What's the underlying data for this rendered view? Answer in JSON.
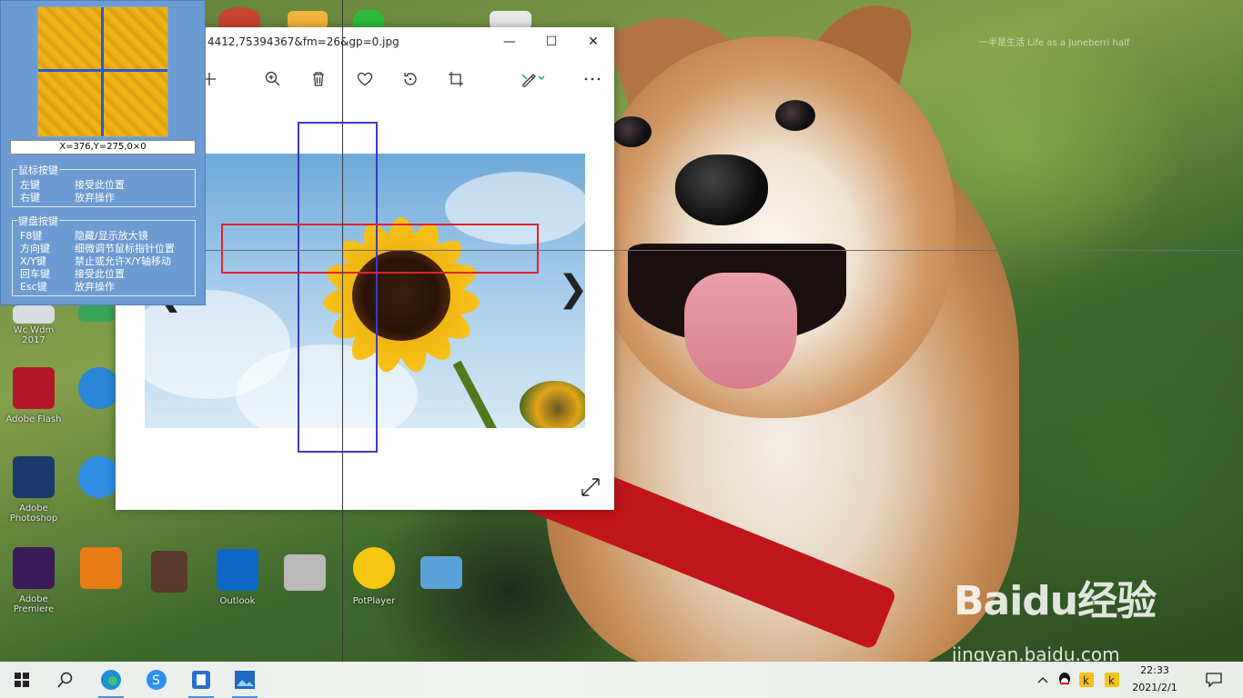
{
  "wallpaper": {
    "caption": "一半是生活 Life as a Juneberri half"
  },
  "desktop_icons": [
    {
      "label": "Wc Wdm 2017",
      "color": "#d7dde0"
    },
    {
      "label": "Adobe Flash",
      "color": "#b3162a"
    },
    {
      "label": "",
      "color": "#2a86d8"
    },
    {
      "label": "Adobe Photoshop",
      "color": "#1b3a6b"
    },
    {
      "label": "",
      "color": "#2f8de3"
    },
    {
      "label": "Adobe Premiere",
      "color": "#3c1a5a"
    },
    {
      "label": "",
      "color": "#e77c16"
    },
    {
      "label": "",
      "color": "#5a3a2a"
    },
    {
      "label": "Outlook",
      "color": "#0e67c4"
    },
    {
      "label": "",
      "color": "#b9b9b9"
    },
    {
      "label": "PotPlayer",
      "color": "#f4c712"
    },
    {
      "label": "",
      "color": "#5aa1d9"
    }
  ],
  "photos_window": {
    "title": "4412,75394367&fm=26&gp=0.jpg",
    "controls": {
      "minimize": "—",
      "maximize": "☐",
      "close": "✕"
    },
    "toolbar": [
      "plus-icon",
      "zoom-in-icon",
      "delete-icon",
      "heart-icon",
      "rotate-icon",
      "crop-icon",
      "edit-icon",
      "more-icon"
    ],
    "prev": "❮",
    "next": "❯"
  },
  "magnifier": {
    "coords": "X=376,Y=275,0×0",
    "mouse_group_title": "鼠标按键",
    "mouse_rows": [
      {
        "key": "左键",
        "action": "接受此位置"
      },
      {
        "key": "右键",
        "action": "放弃操作"
      }
    ],
    "keyboard_group_title": "键盘按键",
    "keyboard_rows": [
      {
        "key": "F8键",
        "action": "隐藏/显示放大镜"
      },
      {
        "key": "方向键",
        "action": "细微调节鼠标指针位置"
      },
      {
        "key": "X/Y键",
        "action": "禁止或允许X/Y轴移动"
      },
      {
        "key": "回车键",
        "action": "接受此位置"
      },
      {
        "key": "Esc键",
        "action": "放弃操作"
      }
    ]
  },
  "taskbar": {
    "time": "22:33",
    "date": "2021/2/1",
    "tray": [
      "chevron-up-icon",
      "qq-icon",
      "k-icon",
      "k-icon"
    ]
  },
  "watermark": {
    "logo": "Baidu经验",
    "url": "jingyan.baidu.com"
  },
  "colors": {
    "magnifier_bg": "#6b9bd1",
    "red_rect": "#e0222a",
    "blue_rect": "#3b3bc4"
  }
}
